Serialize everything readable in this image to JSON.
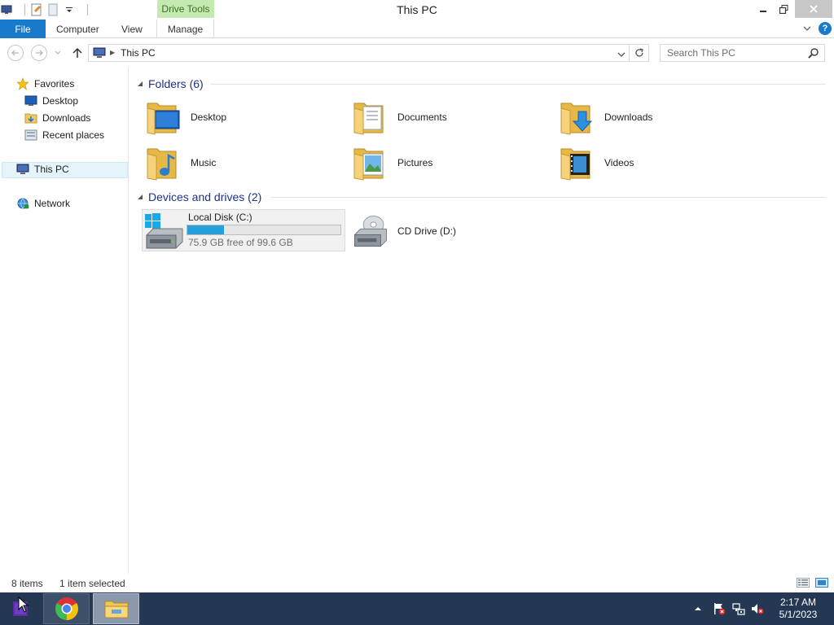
{
  "window": {
    "title": "This PC",
    "context_tab_group": "Drive Tools"
  },
  "ribbon": {
    "tabs": [
      {
        "label": "File",
        "active": false
      },
      {
        "label": "Computer",
        "active": false
      },
      {
        "label": "View",
        "active": false
      },
      {
        "label": "Manage",
        "active": false
      }
    ]
  },
  "address": {
    "crumb": "This PC",
    "search_placeholder": "Search This PC"
  },
  "nav": {
    "favorites": "Favorites",
    "items": [
      {
        "label": "Desktop",
        "icon": "desktop-icon"
      },
      {
        "label": "Downloads",
        "icon": "downloads-folder-icon"
      },
      {
        "label": "Recent places",
        "icon": "recent-places-icon"
      }
    ],
    "this_pc": "This PC",
    "network": "Network"
  },
  "content": {
    "folders_header": "Folders (6)",
    "folders": [
      {
        "label": "Desktop",
        "icon": "desktop-folder-icon"
      },
      {
        "label": "Documents",
        "icon": "documents-folder-icon"
      },
      {
        "label": "Downloads",
        "icon": "downloads-folder-icon"
      },
      {
        "label": "Music",
        "icon": "music-folder-icon"
      },
      {
        "label": "Pictures",
        "icon": "pictures-folder-icon"
      },
      {
        "label": "Videos",
        "icon": "videos-folder-icon"
      }
    ],
    "drives_header": "Devices and drives (2)",
    "drives": [
      {
        "label": "Local Disk (C:)",
        "free_text": "75.9 GB free of 99.6 GB",
        "used_fraction": 0.238,
        "selected": true
      },
      {
        "label": "CD Drive (D:)"
      }
    ]
  },
  "status": {
    "items_count": "8 items",
    "selection": "1 item selected"
  },
  "taskbar": {
    "apps": [
      "chrome-icon",
      "file-explorer-icon"
    ],
    "time": "2:17 AM",
    "date": "5/1/2023"
  },
  "colors": {
    "accent": "#1979ca",
    "drive_bar": "#26a0da",
    "context_tab": "#c4eab2",
    "taskbar": "#243753",
    "group_header": "#1e3287"
  }
}
